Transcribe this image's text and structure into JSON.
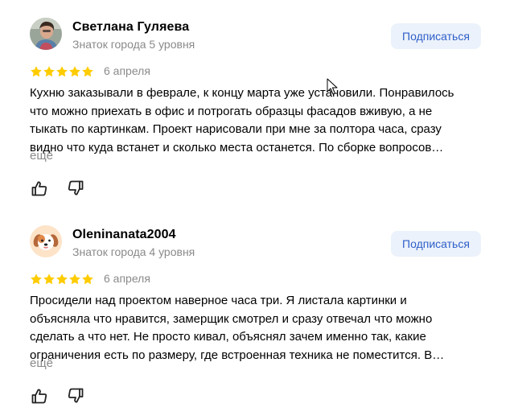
{
  "reviews": [
    {
      "author": "Светлана Гуляева",
      "level": "Знаток города 5 уровня",
      "avatar": "photo-avatar",
      "subscribe_label": "Подписаться",
      "rating": 5,
      "date": "6 апреля",
      "lines": [
        "Кухню заказывали в феврале, к концу марта уже установили. Понравилось",
        "что можно приехать в офис и потрогать образцы фасадов вживую, а не",
        "тыкать по картинкам. Проект нарисовали при мне за полтора часа, сразу",
        "видно что куда встанет и сколько места останется. По сборке вопросов…"
      ],
      "more_label": "ещё",
      "like_icon": "thumbs-up-icon",
      "dislike_icon": "thumbs-down-icon"
    },
    {
      "author": "Oleninanata2004",
      "level": "Знаток города 4 уровня",
      "avatar": "dog-avatar",
      "subscribe_label": "Подписаться",
      "rating": 5,
      "date": "6 апреля",
      "lines": [
        "Просидели над проектом наверное часа три. Я листала картинки и",
        "объясняла что нравится, замерщик смотрел и сразу отвечал что можно",
        "сделать а что нет. Не просто кивал, объяснял зачем именно так, какие",
        "ограничения есть по размеру, где встроенная техника не поместится. В…"
      ],
      "more_label": "ещё",
      "like_icon": "thumbs-up-icon",
      "dislike_icon": "thumbs-down-icon"
    }
  ],
  "colors": {
    "star": "#fc6",
    "star_fill": "#ffcc00",
    "muted_text": "#8a8a8a",
    "button_bg": "#ecf2fb",
    "button_text": "#2e5fc8"
  }
}
